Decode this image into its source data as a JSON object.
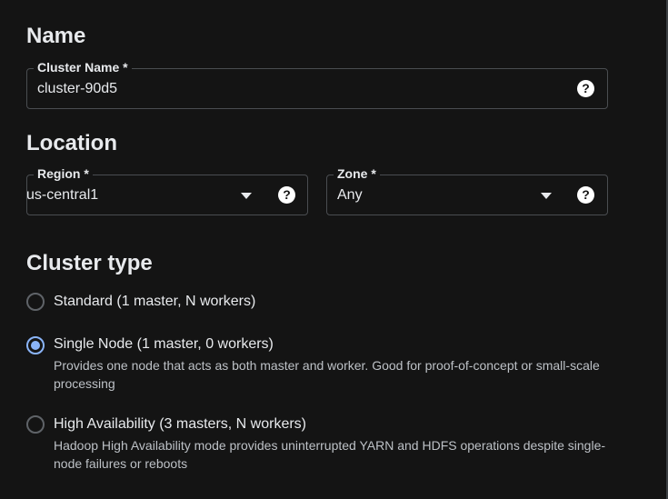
{
  "name_section": {
    "title": "Name",
    "cluster_name": {
      "label": "Cluster Name *",
      "value": "cluster-90d5",
      "help": "?"
    }
  },
  "location_section": {
    "title": "Location",
    "region": {
      "label": "Region *",
      "value": "us-central1",
      "help": "?"
    },
    "zone": {
      "label": "Zone *",
      "value": "Any",
      "help": "?"
    }
  },
  "cluster_type_section": {
    "title": "Cluster type",
    "options": [
      {
        "label": "Standard (1 master, N workers)",
        "description": "",
        "selected": false
      },
      {
        "label": "Single Node (1 master, 0 workers)",
        "description": "Provides one node that acts as both master and worker. Good for proof-of-concept or small-scale processing",
        "selected": true
      },
      {
        "label": "High Availability (3 masters, N workers)",
        "description": "Hadoop High Availability mode provides uninterrupted YARN and HDFS operations despite single-node failures or reboots",
        "selected": false
      }
    ]
  },
  "colors": {
    "background": "#141414",
    "accent": "#8ab4f8",
    "text": "#e8eaed",
    "secondary_text": "#bdc1c6",
    "border": "#4a4d51"
  }
}
